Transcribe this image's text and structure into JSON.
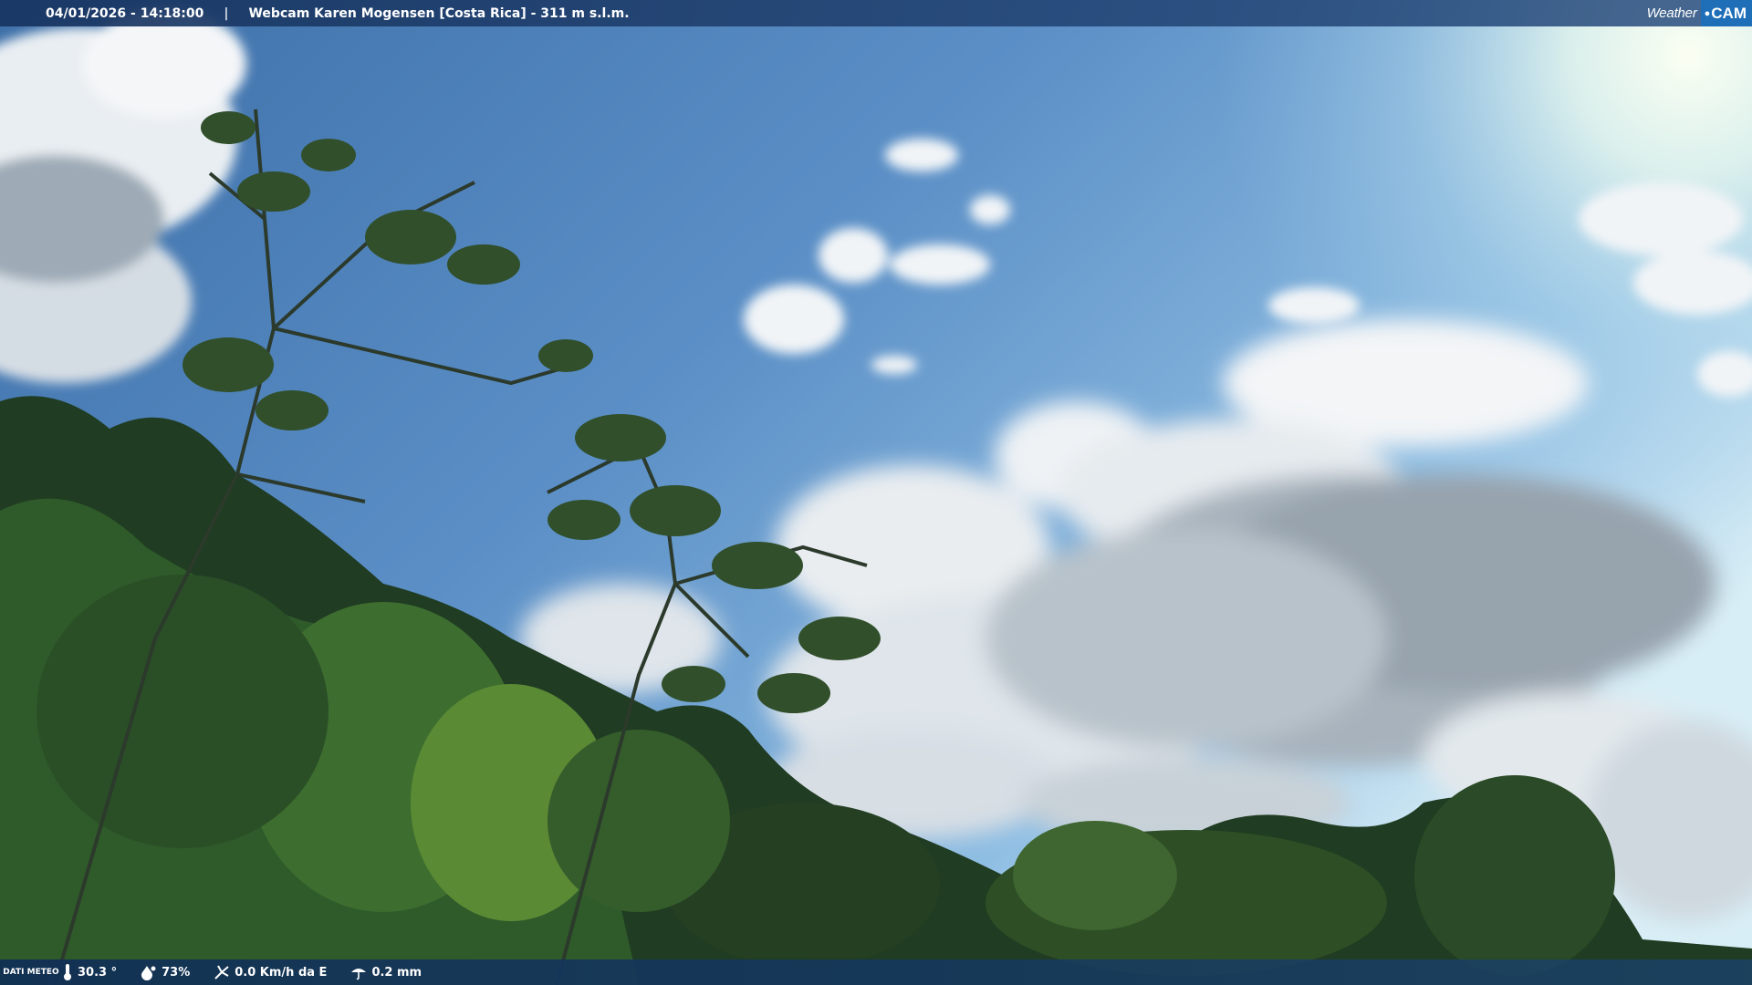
{
  "header": {
    "datetime": "04/01/2026 - 14:18:00",
    "separator": "|",
    "location": "Webcam Karen Mogensen [Costa Rica] - 311 m s.l.m."
  },
  "logo": {
    "weather": "Weather",
    "cam": "CAM"
  },
  "weather_bar": {
    "label": "DATI METEO",
    "temperature": "30.3 °",
    "humidity": "73%",
    "wind": "0.0 Km/h da E",
    "rain": "0.2 mm"
  },
  "icons": [
    "thermometer-icon",
    "humidity-drop-icon",
    "wind-icon",
    "rain-icon"
  ]
}
